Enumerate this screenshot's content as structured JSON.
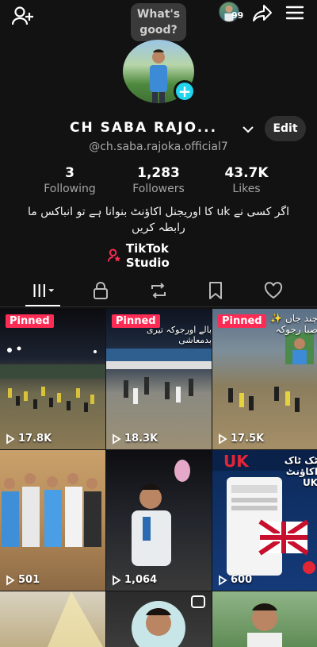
{
  "bubble": {
    "text": "What's good?"
  },
  "top": {
    "friends_count": "99"
  },
  "profile": {
    "display_name": "CH SABA RAJO...",
    "handle": "@ch.saba.rajoka.official7",
    "edit_label": "Edit",
    "bio": "اگر کسی نے uk کا اوریجنل اکاؤنٹ بنوانا ہے تو انباکس ما رابطہ کریں",
    "studio_label": "TikTok Studio"
  },
  "stats": {
    "following": {
      "value": "3",
      "label": "Following"
    },
    "followers": {
      "value": "1,283",
      "label": "Followers"
    },
    "likes": {
      "value": "43.7K",
      "label": "Likes"
    }
  },
  "tabs": [
    {
      "name": "videos",
      "icon": "grid-icon",
      "active": true
    },
    {
      "name": "private",
      "icon": "lock-icon"
    },
    {
      "name": "reposts",
      "icon": "repost-icon"
    },
    {
      "name": "favorites",
      "icon": "bookmark-icon"
    },
    {
      "name": "liked",
      "icon": "heart-icon"
    }
  ],
  "videos": [
    {
      "pinned": "Pinned",
      "views": "17.8K"
    },
    {
      "pinned": "Pinned",
      "views": "18.3K",
      "caption": "بالے اورجوکہ تیری بدمعاشی"
    },
    {
      "pinned": "Pinned",
      "views": "17.5K",
      "caption": "چند جاں ✨ صبا رجوکہ"
    },
    {
      "views": "501"
    },
    {
      "views": "1,064"
    },
    {
      "views": "600",
      "caption": "ٹک ٹاک اکاؤنٹ UK"
    },
    {},
    {},
    {}
  ],
  "colors": {
    "accent": "#fe2c55",
    "badge": "#20d5ec",
    "background": "#121212"
  }
}
